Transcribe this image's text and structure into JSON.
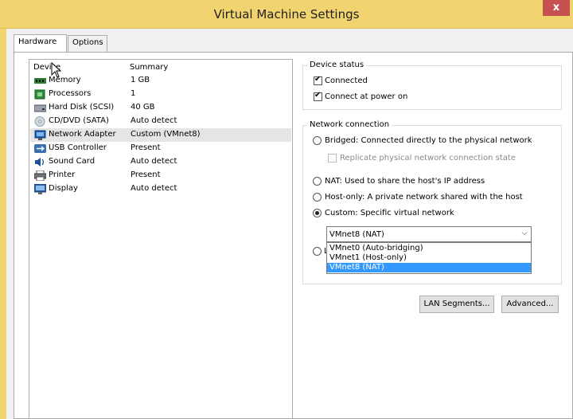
{
  "window": {
    "title": "Virtual Machine Settings",
    "close_label": "x"
  },
  "tabs": [
    {
      "label": "Hardware",
      "active": true
    },
    {
      "label": "Options",
      "active": false
    }
  ],
  "device_list": {
    "col_device": "Device",
    "col_summary": "Summary",
    "items": [
      {
        "name": "Memory",
        "summary": "1 GB",
        "icon": "memory-icon"
      },
      {
        "name": "Processors",
        "summary": "1",
        "icon": "processor-icon"
      },
      {
        "name": "Hard Disk (SCSI)",
        "summary": "40 GB",
        "icon": "hard-disk-icon"
      },
      {
        "name": "CD/DVD (SATA)",
        "summary": "Auto detect",
        "icon": "cd-dvd-icon"
      },
      {
        "name": "Network Adapter",
        "summary": "Custom (VMnet8)",
        "icon": "network-adapter-icon",
        "selected": true
      },
      {
        "name": "USB Controller",
        "summary": "Present",
        "icon": "usb-icon"
      },
      {
        "name": "Sound Card",
        "summary": "Auto detect",
        "icon": "sound-icon"
      },
      {
        "name": "Printer",
        "summary": "Present",
        "icon": "printer-icon"
      },
      {
        "name": "Display",
        "summary": "Auto detect",
        "icon": "display-icon"
      }
    ]
  },
  "device_status": {
    "title": "Device status",
    "connected": "Connected",
    "connect_at_power_on": "Connect at power on"
  },
  "network_connection": {
    "title": "Network connection",
    "bridged": "Bridged: Connected directly to the physical network",
    "replicate": "Replicate physical network connection state",
    "nat": "NAT: Used to share the host's IP address",
    "host_only": "Host-only: A private network shared with the host",
    "custom": "Custom: Specific virtual network",
    "lan_partial": "L",
    "selected_network": "VMnet8 (NAT)",
    "options": [
      "VMnet0 (Auto-bridging)",
      "VMnet1 (Host-only)",
      "VMnet8 (NAT)"
    ]
  },
  "buttons": {
    "lan_segments": "LAN Segments...",
    "advanced": "Advanced..."
  }
}
